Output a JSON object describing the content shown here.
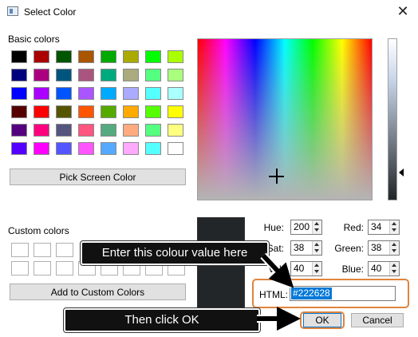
{
  "window": {
    "title": "Select Color",
    "close_glyph": "✕"
  },
  "basic_colors_label": "Basic colors",
  "basic_colors": [
    [
      "#000000",
      "#aa0000",
      "#005500",
      "#aa5500",
      "#00aa00",
      "#aaaa00",
      "#00ff00",
      "#aaff00"
    ],
    [
      "#00007f",
      "#aa007f",
      "#00557f",
      "#aa557f",
      "#00aa7f",
      "#aaaa7f",
      "#55ff7f",
      "#aaff7f"
    ],
    [
      "#0000ff",
      "#aa00ff",
      "#0055ff",
      "#aa55ff",
      "#00aaff",
      "#aaaaff",
      "#55ffff",
      "#aaffff"
    ],
    [
      "#550000",
      "#ff0000",
      "#555500",
      "#ff5500",
      "#55aa00",
      "#ffaa00",
      "#55ff00",
      "#ffff00"
    ],
    [
      "#55007f",
      "#ff007f",
      "#55557f",
      "#ff557f",
      "#55aa7f",
      "#ffaa7f",
      "#55ff7f",
      "#ffff7f"
    ],
    [
      "#5500ff",
      "#ff00ff",
      "#5555ff",
      "#ff55ff",
      "#55aaff",
      "#ffaaff",
      "#55ffff",
      "#ffffff"
    ]
  ],
  "pick_screen_color_label": "Pick Screen Color",
  "custom_colors_label": "Custom colors",
  "add_custom_label": "Add to Custom Colors",
  "fields": {
    "hue": {
      "label": "Hue:",
      "value": "200"
    },
    "sat": {
      "label": "Sat:",
      "value": "38"
    },
    "val": {
      "label": "Val:",
      "value": "40"
    },
    "red": {
      "label": "Red:",
      "value": "34"
    },
    "green": {
      "label": "Green:",
      "value": "38"
    },
    "blue": {
      "label": "Blue:",
      "value": "40"
    }
  },
  "html_label": "HTML:",
  "html_value": "#222628",
  "current_color": "#222628",
  "ok_label": "OK",
  "cancel_label": "Cancel",
  "callouts": {
    "enter_value": "Enter this colour value here",
    "click_ok": "Then click OK"
  },
  "annotation_color": "#e0843c"
}
